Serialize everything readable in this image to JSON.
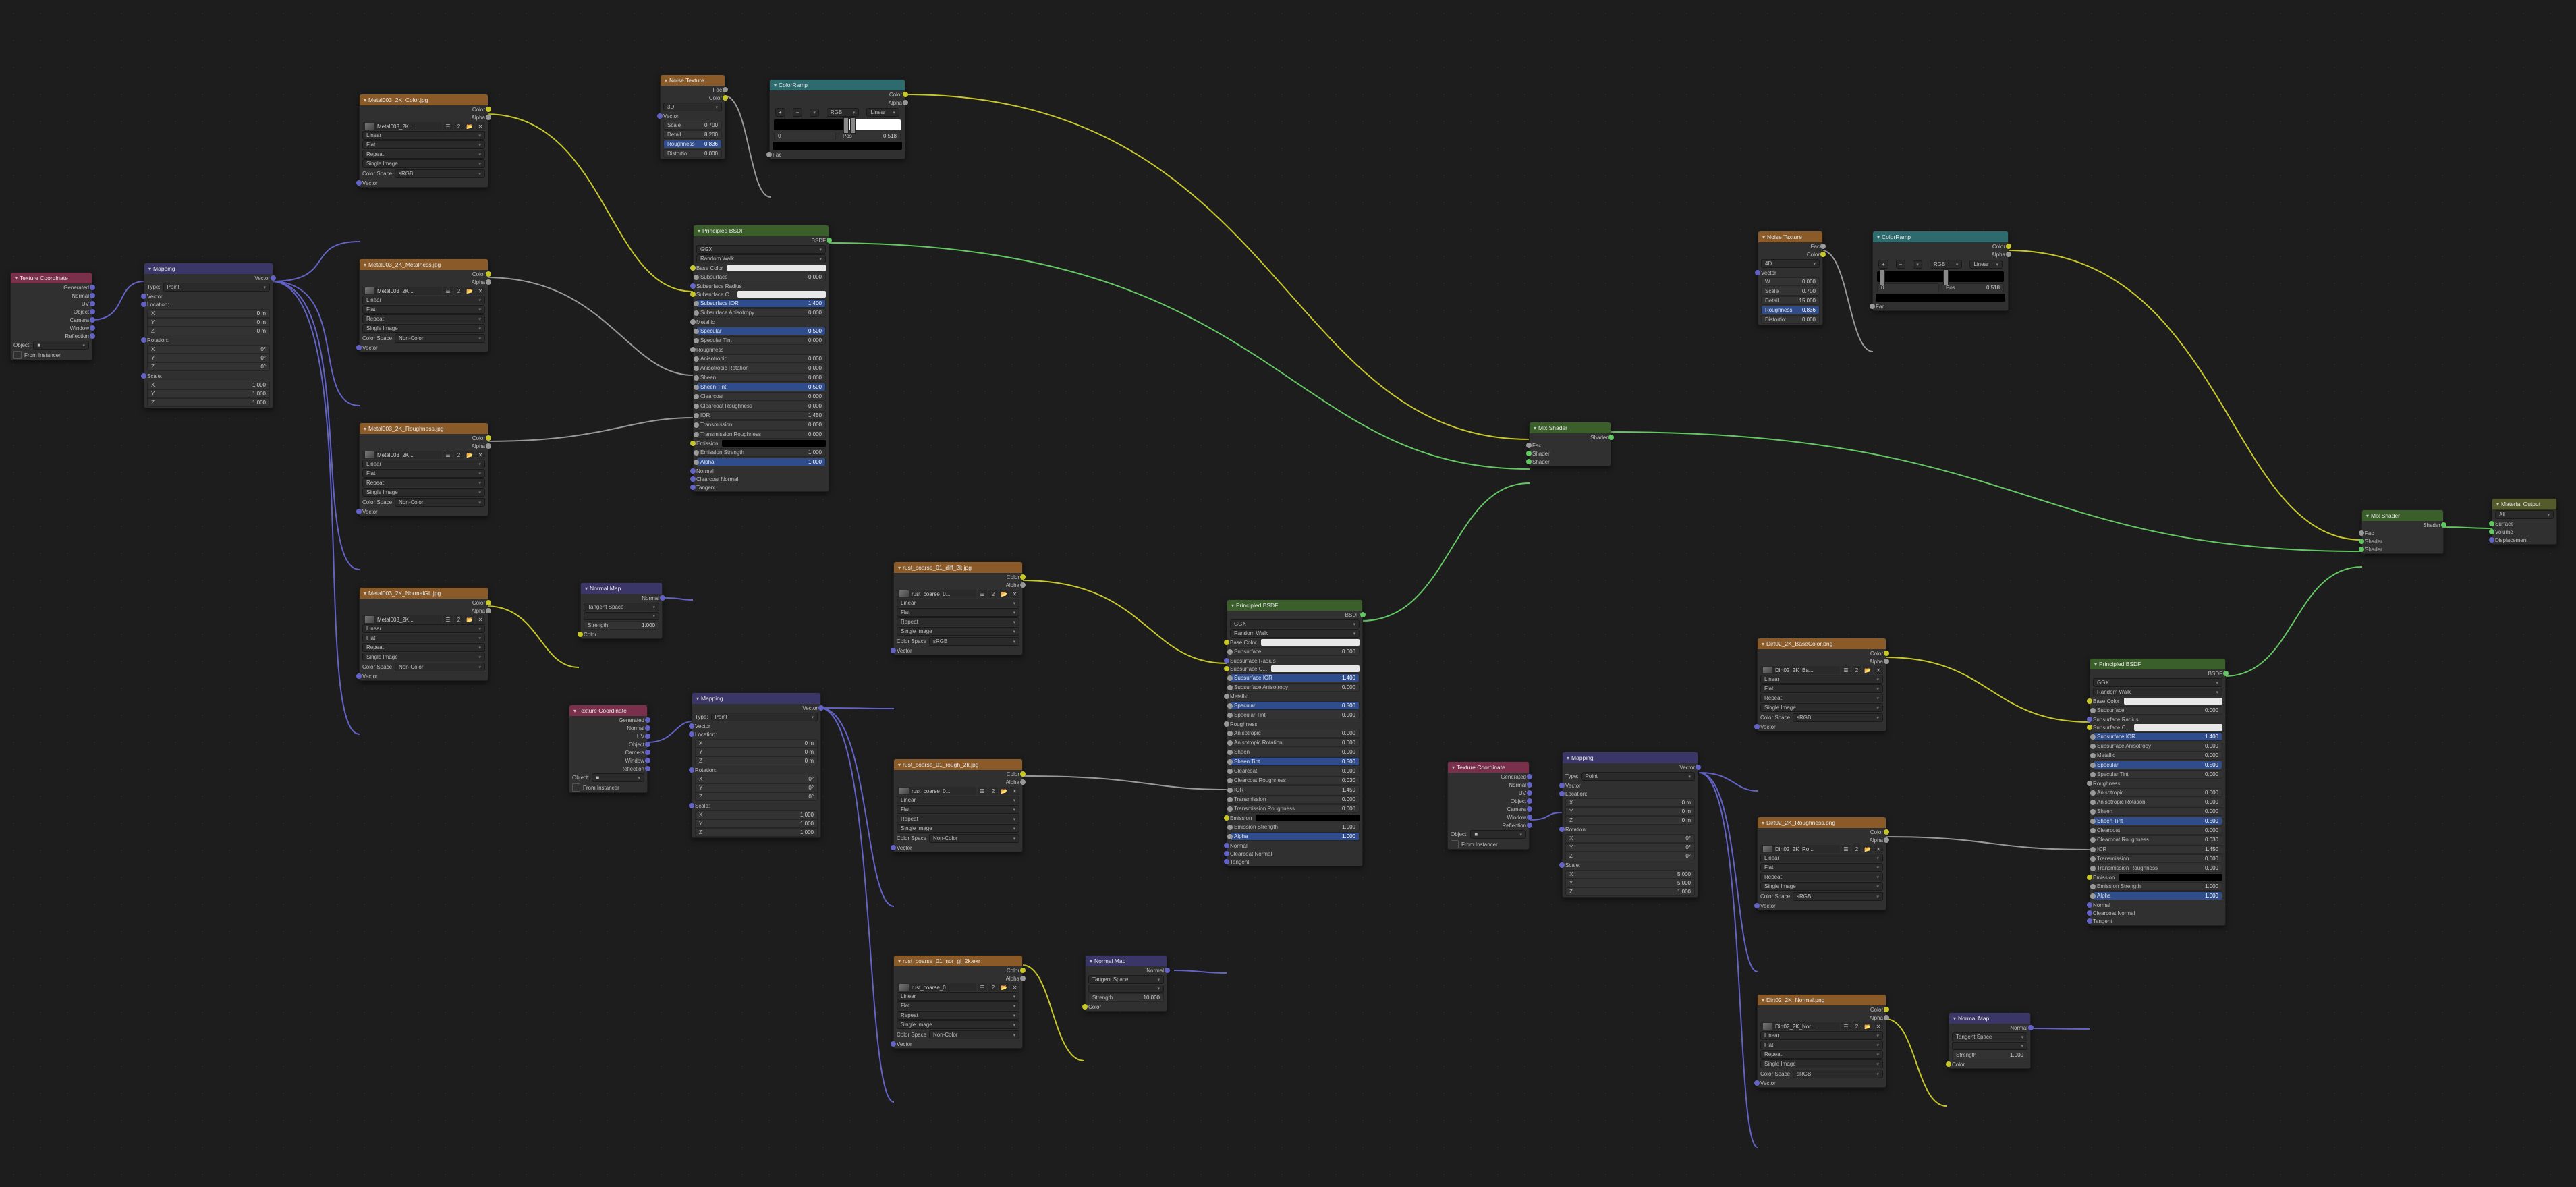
{
  "nodes": {
    "texcoord1": {
      "title": "Texture Coordinate",
      "outs": [
        "Generated",
        "Normal",
        "UV",
        "Object",
        "Camera",
        "Window",
        "Reflection"
      ],
      "obj_label": "Object:",
      "from_instancer": "From Instancer"
    },
    "mapping1": {
      "title": "Mapping",
      "out": "Vector",
      "type_label": "Type:",
      "type_value": "Point",
      "in_vec": "Vector",
      "loc": "Location:",
      "rot": "Rotation:",
      "scl": "Scale:",
      "loc_x": "0 m",
      "loc_y": "0 m",
      "loc_z": "0 m",
      "rot_x": "0°",
      "rot_y": "0°",
      "rot_z": "0°",
      "scl_x": "1.000",
      "scl_y": "1.000",
      "scl_z": "1.000",
      "axis_x": "X",
      "axis_y": "Y",
      "axis_z": "Z"
    },
    "img_color": {
      "title": "Metal003_2K_Color.jpg",
      "outs": [
        "Color",
        "Alpha"
      ],
      "file": "Metal003_2K...",
      "interp": "Linear",
      "proj": "Flat",
      "ext": "Repeat",
      "single": "Single Image",
      "cs_l": "Color Space",
      "cs_v": "sRGB",
      "vec": "Vector"
    },
    "img_metal": {
      "title": "Metal003_2K_Metalness.jpg",
      "outs": [
        "Color",
        "Alpha"
      ],
      "file": "Metal003_2K...",
      "interp": "Linear",
      "proj": "Flat",
      "ext": "Repeat",
      "single": "Single Image",
      "cs_l": "Color Space",
      "cs_v": "Non-Color",
      "vec": "Vector"
    },
    "img_rough": {
      "title": "Metal003_2K_Roughness.jpg",
      "outs": [
        "Color",
        "Alpha"
      ],
      "file": "Metal003_2K...",
      "interp": "Linear",
      "proj": "Flat",
      "ext": "Repeat",
      "single": "Single Image",
      "cs_l": "Color Space",
      "cs_v": "Non-Color",
      "vec": "Vector"
    },
    "img_normal": {
      "title": "Metal003_2K_NormalGL.jpg",
      "outs": [
        "Color",
        "Alpha"
      ],
      "file": "Metal003_2K...",
      "interp": "Linear",
      "proj": "Flat",
      "ext": "Repeat",
      "single": "Single Image",
      "cs_l": "Color Space",
      "cs_v": "Non-Color",
      "vec": "Vector"
    },
    "noise1": {
      "title": "Noise Texture",
      "outs": [
        "Fac",
        "Color"
      ],
      "dim": "3D",
      "vec": "Vector",
      "scale_l": "Scale",
      "scale_v": "0.700",
      "detail_l": "Detail",
      "detail_v": "8.200",
      "rough_l": "Roughness",
      "rough_v": "0.836",
      "dist_l": "Distortio:",
      "dist_v": "0.000"
    },
    "noise2": {
      "title": "Noise Texture",
      "outs": [
        "Fac",
        "Color"
      ],
      "dim": "4D",
      "vec": "Vector",
      "w_l": "W",
      "w_v": "0.000",
      "scale_l": "Scale",
      "scale_v": "0.700",
      "detail_l": "Detail",
      "detail_v": "15.000",
      "rough_l": "Roughness",
      "rough_v": "0.836",
      "dist_l": "Distortio:",
      "dist_v": "0.000"
    },
    "cr1": {
      "title": "ColorRamp",
      "outs": [
        "Color",
        "Alpha"
      ],
      "mode_a": "RGB",
      "mode_b": "Linear",
      "pos_l": "Pos",
      "pos_v": "0.518",
      "idx": "0",
      "fac": "Fac"
    },
    "cr2": {
      "title": "ColorRamp",
      "outs": [
        "Color",
        "Alpha"
      ],
      "mode_a": "RGB",
      "mode_b": "Linear",
      "pos_l": "Pos",
      "pos_v": "0.518",
      "idx": "0",
      "fac": "Fac"
    },
    "normalmap1": {
      "title": "Normal Map",
      "out": "Normal",
      "space": "Tangent Space",
      "strength_l": "Strength",
      "strength_v": "1.000",
      "color": "Color"
    },
    "normalmap2": {
      "title": "Normal Map",
      "out": "Normal",
      "space": "Tangent Space",
      "strength_l": "Strength",
      "strength_v": "10.000",
      "color": "Color"
    },
    "normalmap3": {
      "title": "Normal Map",
      "out": "Normal",
      "space": "Tangent Space",
      "strength_l": "Strength",
      "strength_v": "1.000",
      "color": "Color"
    },
    "principleds": {
      "out": "BSDF",
      "dist": "GGX",
      "sss": "Random Walk",
      "rows": [
        "Base Color",
        "Subsurface",
        "Subsurface Radius",
        "Subsurface C...",
        "Subsurface IOR",
        "Subsurface Anisotropy",
        "Metallic",
        "Specular",
        "Specular Tint",
        "Roughness",
        "Anisotropic",
        "Anisotropic Rotation",
        "Sheen",
        "Sheen Tint",
        "Clearcoat",
        "Clearcoat Roughness",
        "IOR",
        "Transmission",
        "Transmission Roughness",
        "Emission",
        "Emission Strength",
        "Alpha",
        "Normal",
        "Clearcoat Normal",
        "Tangent"
      ],
      "vals1": {
        "Subsurface": "0.000",
        "Subsurface IOR": "1.400",
        "Subsurface Anisotropy": "0.000",
        "Specular": "0.500",
        "Specular Tint": "0.000",
        "Anisotropic": "0.000",
        "Anisotropic Rotation": "0.000",
        "Sheen": "0.000",
        "Sheen Tint": "0.500",
        "Clearcoat": "0.000",
        "Clearcoat Roughness": "0.000",
        "IOR": "1.450",
        "Transmission": "0.000",
        "Transmission Roughness": "0.000",
        "Emission Strength": "1.000",
        "Alpha": "1.000"
      },
      "vals2": {
        "Subsurface": "0.000",
        "Subsurface IOR": "1.400",
        "Subsurface Anisotropy": "0.000",
        "Specular": "0.500",
        "Specular Tint": "0.000",
        "Anisotropic": "0.000",
        "Anisotropic Rotation": "0.000",
        "Sheen": "0.000",
        "Sheen Tint": "0.500",
        "Clearcoat": "0.000",
        "Clearcoat Roughness": "0.030",
        "IOR": "1.450",
        "Transmission": "0.000",
        "Transmission Roughness": "0.000",
        "Emission Strength": "1.000",
        "Alpha": "1.000"
      },
      "vals3": {
        "Subsurface": "0.000",
        "Subsurface IOR": "1.400",
        "Subsurface Anisotropy": "0.000",
        "Metallic": "0.000",
        "Specular": "0.500",
        "Specular Tint": "0.000",
        "Anisotropic": "0.000",
        "Anisotropic Rotation": "0.000",
        "Sheen": "0.000",
        "Sheen Tint": "0.500",
        "Clearcoat": "0.000",
        "Clearcoat Roughness": "0.030",
        "IOR": "1.450",
        "Transmission": "0.000",
        "Transmission Roughness": "0.000",
        "Emission Strength": "1.000",
        "Alpha": "1.000"
      },
      "title": "Principled BSDF",
      "blue": [
        "Subsurface IOR",
        "Specular",
        "Sheen Tint",
        "Alpha"
      ]
    },
    "texcoord2": {
      "title": "Texture Coordinate"
    },
    "mapping2": {
      "title": "Mapping"
    },
    "img_diff2": {
      "title": "rust_coarse_01_diff_2k.jpg",
      "file": "rust_coarse_0...",
      "cs_v": "sRGB"
    },
    "img_rough2": {
      "title": "rust_coarse_01_rough_2k.jpg",
      "file": "rust_coarse_0...",
      "cs_v": "Non-Color"
    },
    "img_nor2": {
      "title": "rust_coarse_01_nor_gl_2k.exr",
      "file": "rust_coarse_0...",
      "cs_v": "Non-Color"
    },
    "texcoord3": {
      "title": "Texture Coordinate"
    },
    "mapping3": {
      "title": "Mapping",
      "scl_x": "5.000",
      "scl_y": "5.000",
      "scl_z": "1.000"
    },
    "img_base3": {
      "title": "Dirt02_2K_BaseColor.png",
      "file": "Dirt02_2K_Ba...",
      "cs_v": "sRGB"
    },
    "img_rough3": {
      "title": "Dirt02_2K_Roughness.png",
      "file": "Dirt02_2K_Ro...",
      "cs_v": "sRGB"
    },
    "img_nor3": {
      "title": "Dirt02_2K_Normal.png",
      "file": "Dirt02_2K_Nor...",
      "cs_v": "sRGB"
    },
    "mix1": {
      "title": "Mix Shader",
      "out": "Shader",
      "fac": "Fac",
      "s1": "Shader",
      "s2": "Shader"
    },
    "mix2": {
      "title": "Mix Shader"
    },
    "matout": {
      "title": "Material Output",
      "target": "All",
      "surf": "Surface",
      "vol": "Volume",
      "disp": "Displacement"
    }
  }
}
